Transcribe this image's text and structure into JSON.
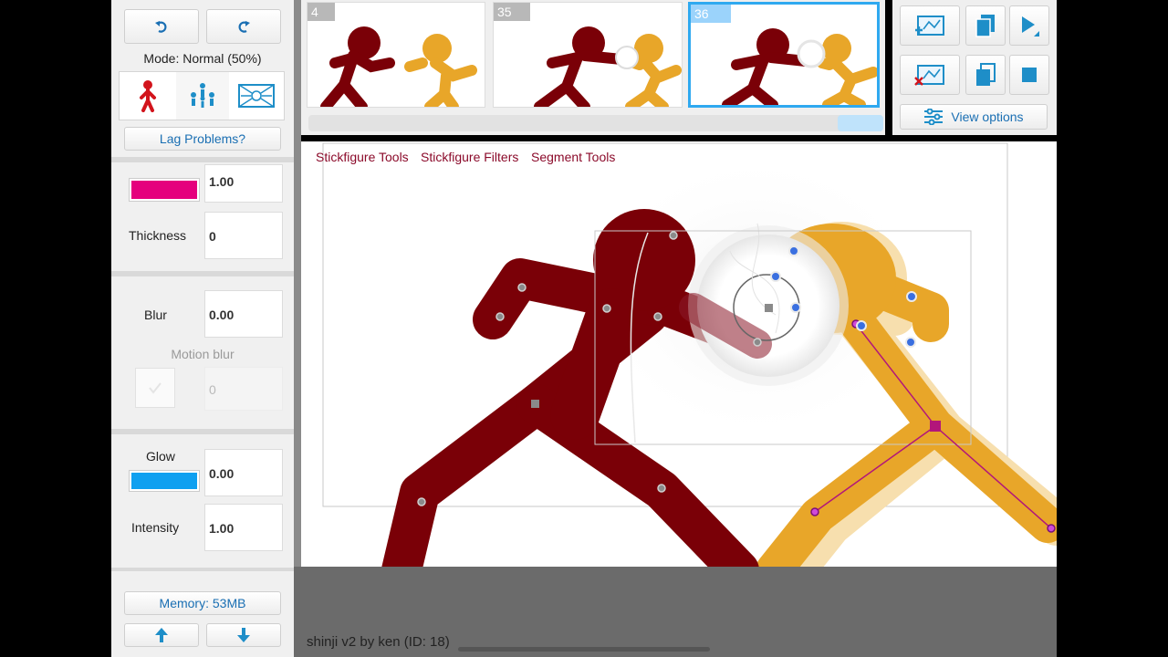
{
  "mode_label": "Mode: Normal (50%)",
  "lag_button": "Lag Problems?",
  "props": {
    "color_value": "1.00",
    "thickness_label": "Thickness",
    "thickness_value": "0",
    "blur_label": "Blur",
    "blur_value": "0.00",
    "motion_blur_label": "Motion blur",
    "motion_blur_value": "0",
    "glow_label": "Glow",
    "glow_value": "0.00",
    "intensity_label": "Intensity",
    "intensity_value": "1.00"
  },
  "colors": {
    "stick_color": "#e5007d",
    "glow_color": "#0fa0f0",
    "red_figure": "#7a0007",
    "yellow_figure": "#e8a629"
  },
  "memory_button": "Memory: 53MB",
  "frames": [
    {
      "num": "4"
    },
    {
      "num": "35"
    },
    {
      "num": "36"
    }
  ],
  "view_options": "View options",
  "canvas_menu": {
    "stickfigure_tools": "Stickfigure Tools",
    "stickfigure_filters": "Stickfigure Filters",
    "segment_tools": "Segment Tools"
  },
  "status_text": "shinji v2 by ken (ID: 18)",
  "icons": [
    "undo-icon",
    "redo-icon",
    "stickfigure-mode-icon",
    "group-mode-icon",
    "background-mode-icon",
    "add-frame-icon",
    "copy-frame-icon",
    "play-icon",
    "delete-frame-icon",
    "paste-frame-icon",
    "stop-icon",
    "settings-sliders-icon",
    "up-arrow-icon",
    "down-arrow-icon"
  ]
}
